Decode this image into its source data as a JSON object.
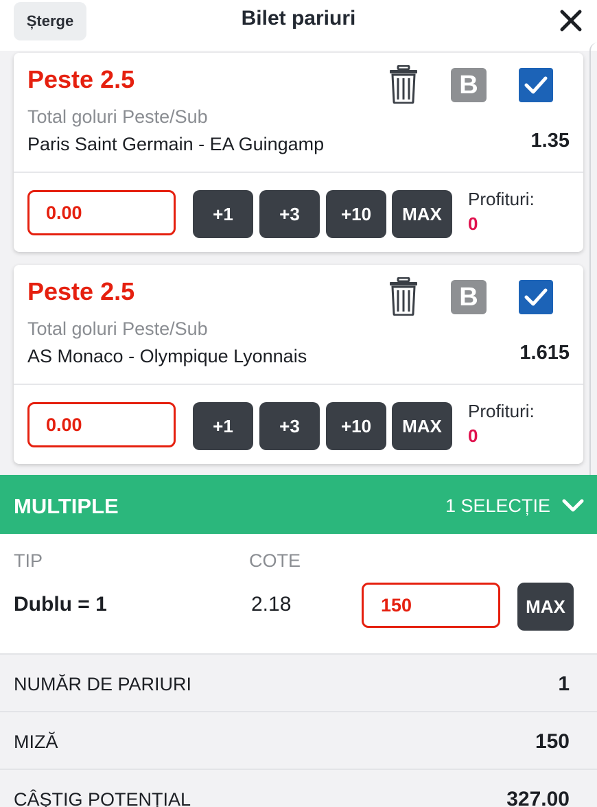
{
  "header": {
    "clear_label": "Șterge",
    "title": "Bilet pariuri"
  },
  "bets": [
    {
      "name": "Peste 2.5",
      "market": "Total goluri Peste/Sub",
      "event": "Paris Saint Germain - EA Guingamp",
      "odds": "1.35",
      "stake": "0.00",
      "quick_stakes": [
        "+1",
        "+3",
        "+10",
        "MAX"
      ],
      "profit_label": "Profituri:",
      "profit_value": "0",
      "bank_label": "B",
      "selected": true
    },
    {
      "name": "Peste 2.5",
      "market": "Total goluri Peste/Sub",
      "event": "AS Monaco - Olympique Lyonnais",
      "odds": "1.615",
      "stake": "0.00",
      "quick_stakes": [
        "+1",
        "+3",
        "+10",
        "MAX"
      ],
      "profit_label": "Profituri:",
      "profit_value": "0",
      "bank_label": "B",
      "selected": true
    }
  ],
  "multiple": {
    "title": "MULTIPLE",
    "selection_count": "1 SELECȚIE",
    "type_header": "TIP",
    "odds_header": "COTE",
    "type_value": "Dublu = 1",
    "odds_value": "2.18",
    "stake": "150",
    "max_label": "MAX"
  },
  "summary": [
    {
      "label": "NUMĂR DE PARIURI",
      "value": "1"
    },
    {
      "label": "MIZĂ",
      "value": "150"
    },
    {
      "label": "CÂȘTIG POTENȚIAL",
      "value": "327.00"
    }
  ],
  "colors": {
    "accent_red": "#e5200f",
    "profit_pink": "#e0114d",
    "multiple_green": "#2bb77c",
    "checkbox_blue": "#1c63b7",
    "dark_button": "#3a3f46"
  }
}
